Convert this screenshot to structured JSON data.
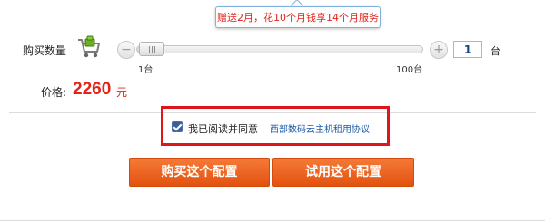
{
  "promo": {
    "tooltip": "赠送2月，花10个月钱享14个月服务"
  },
  "quantity": {
    "label": "购买数量",
    "slider": {
      "min_label": "1台",
      "max_label": "100台",
      "value": 1,
      "min": 1,
      "max": 100
    },
    "minus_symbol": "−",
    "plus_symbol": "+",
    "input_value": "1",
    "unit": "台"
  },
  "price": {
    "label": "价格:",
    "value": "2260",
    "unit": "元"
  },
  "agreement": {
    "checked": true,
    "text": "我已阅读并同意",
    "link_text": "西部数码云主机租用协议"
  },
  "actions": {
    "buy_label": "购买这个配置",
    "try_label": "试用这个配置"
  },
  "icons": {
    "quantity": "shopping-cart-icon"
  },
  "colors": {
    "accent": "#e2231a",
    "button": "#f06a2a",
    "link": "#1e5aa8",
    "highlight_border": "#e0151b"
  }
}
